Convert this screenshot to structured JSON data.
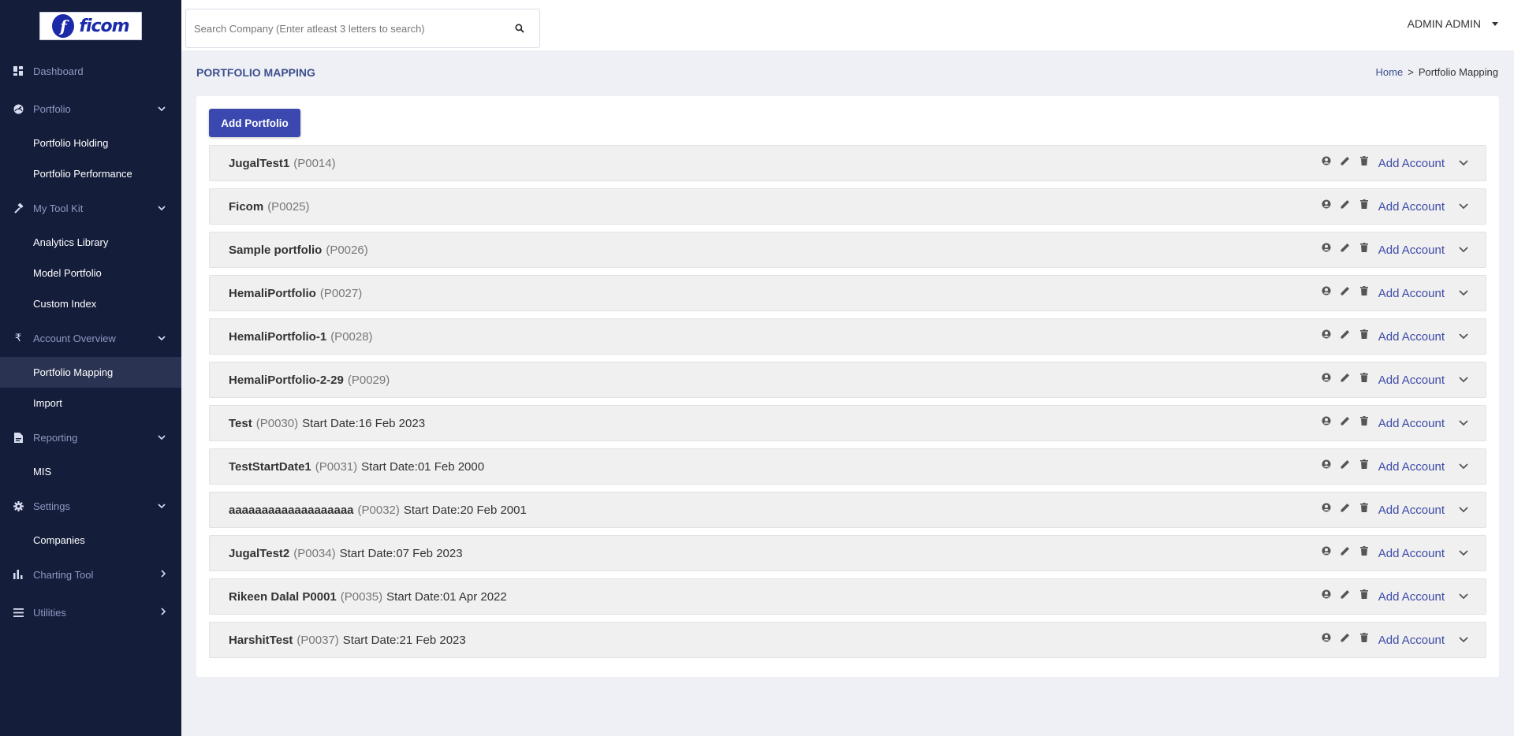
{
  "brand": {
    "logo_text": "ficom"
  },
  "sidebar": {
    "dashboard": "Dashboard",
    "portfolio": "Portfolio",
    "portfolio_holding": "Portfolio Holding",
    "portfolio_performance": "Portfolio Performance",
    "my_tool_kit": "My Tool Kit",
    "analytics_library": "Analytics Library",
    "model_portfolio": "Model Portfolio",
    "custom_index": "Custom Index",
    "account_overview": "Account Overview",
    "portfolio_mapping": "Portfolio Mapping",
    "import": "Import",
    "reporting": "Reporting",
    "mis": "MIS",
    "settings": "Settings",
    "companies": "Companies",
    "charting_tool": "Charting Tool",
    "utilities": "Utilities"
  },
  "search": {
    "placeholder": "Search Company (Enter atleast 3 letters to search)"
  },
  "user": {
    "name": "ADMIN ADMIN"
  },
  "page": {
    "title": "PORTFOLIO MAPPING",
    "breadcrumb": {
      "home": "Home",
      "separator": ">",
      "current": "Portfolio Mapping"
    },
    "add_button": "Add Portfolio",
    "add_account_label": "Add Account"
  },
  "portfolios": [
    {
      "name": "JugalTest1",
      "code": "(P0014)",
      "start": ""
    },
    {
      "name": "Ficom",
      "code": "(P0025)",
      "start": ""
    },
    {
      "name": "Sample portfolio",
      "code": "(P0026)",
      "start": ""
    },
    {
      "name": "HemaliPortfolio",
      "code": "(P0027)",
      "start": ""
    },
    {
      "name": "HemaliPortfolio-1",
      "code": "(P0028)",
      "start": ""
    },
    {
      "name": "HemaliPortfolio-2-29",
      "code": "(P0029)",
      "start": ""
    },
    {
      "name": "Test",
      "code": "(P0030)",
      "start": "Start Date:16 Feb 2023"
    },
    {
      "name": "TestStartDate1",
      "code": "(P0031)",
      "start": "Start Date:01 Feb 2000"
    },
    {
      "name": "aaaaaaaaaaaaaaaaaaa",
      "code": "(P0032)",
      "start": "Start Date:20 Feb 2001"
    },
    {
      "name": "JugalTest2",
      "code": "(P0034)",
      "start": "Start Date:07 Feb 2023"
    },
    {
      "name": "Rikeen Dalal P0001",
      "code": "(P0035)",
      "start": "Start Date:01 Apr 2022"
    },
    {
      "name": "HarshitTest",
      "code": "(P0037)",
      "start": "Start Date:21 Feb 2023"
    }
  ],
  "colors": {
    "sidebar_bg": "#141d3a",
    "accent": "#3a48b0",
    "link": "#3d4aa8",
    "title": "#3d4f8f"
  }
}
